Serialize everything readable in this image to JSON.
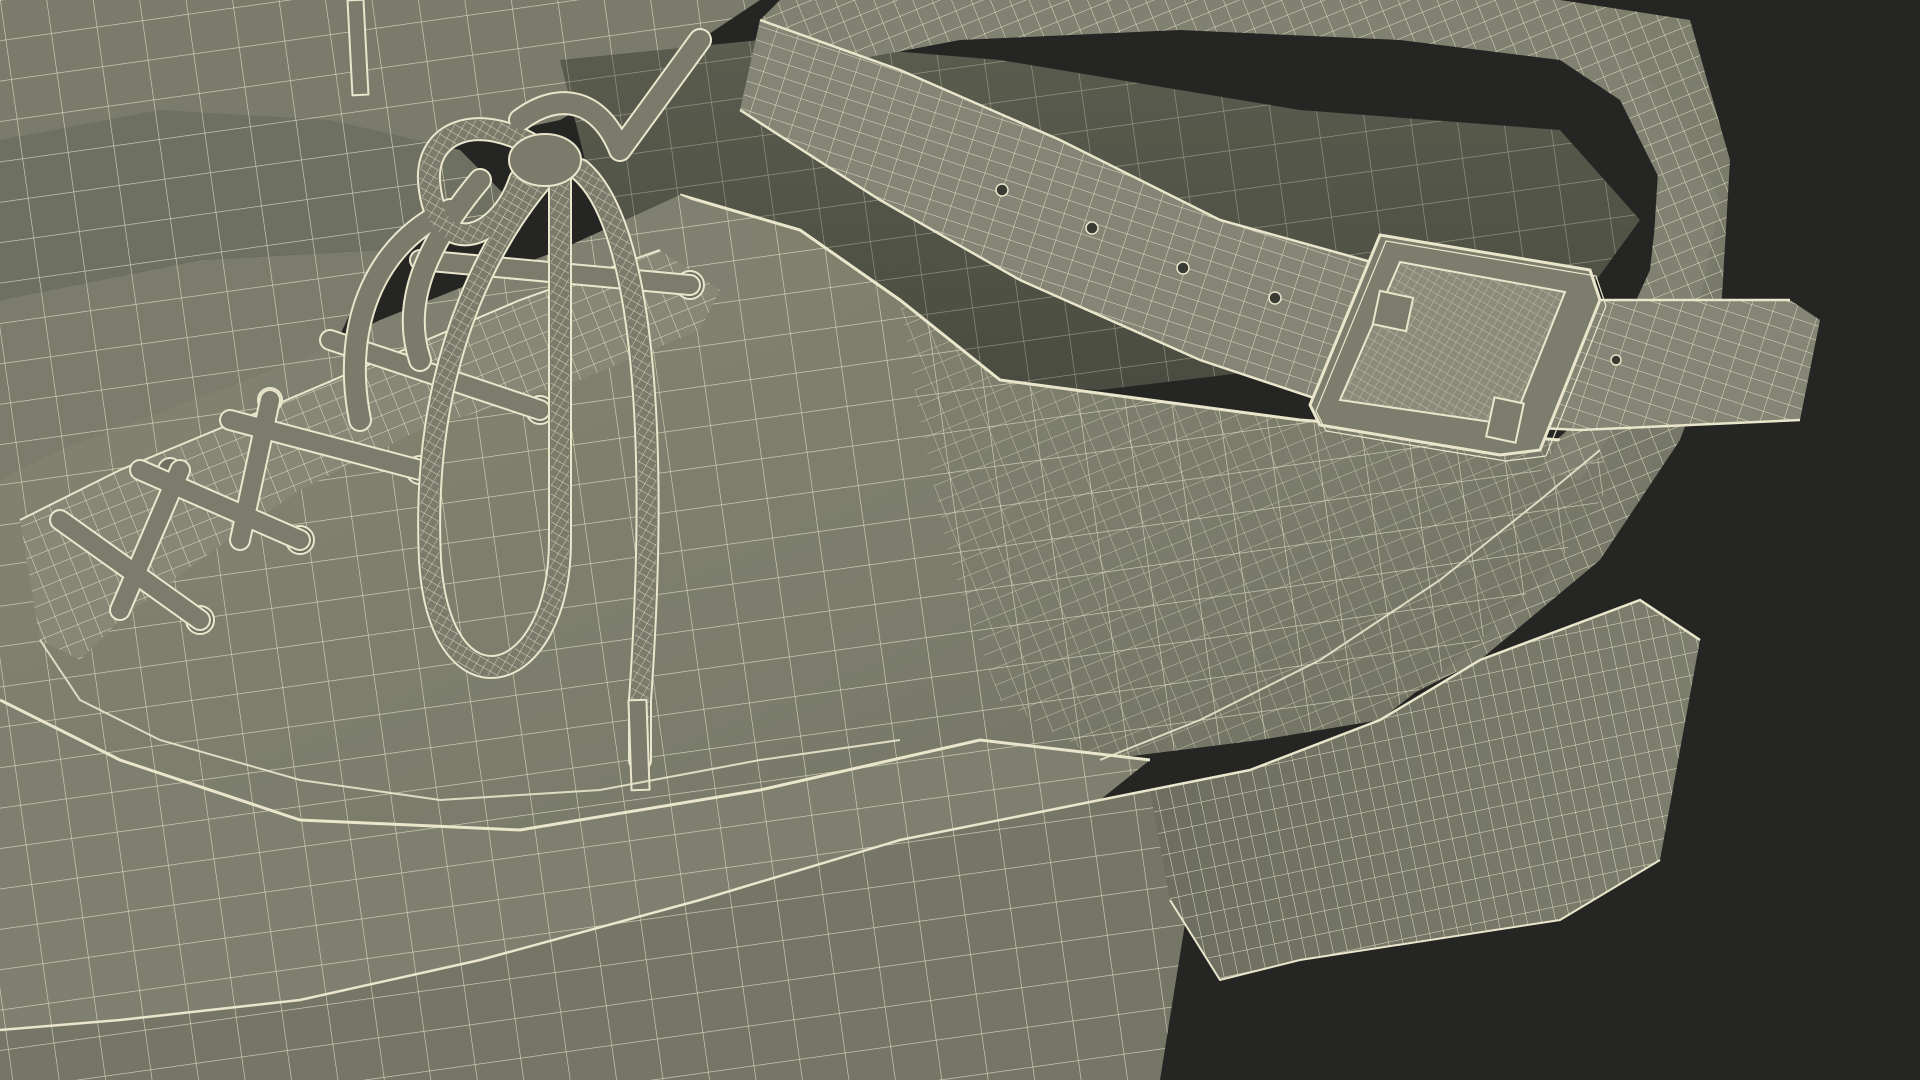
{
  "scene": {
    "subject": "shoe-wireframe-render",
    "colors": {
      "background": "#252624",
      "surface": "#7d7d6d",
      "surface_light": "#8a8a79",
      "surface_dark": "#5f6152",
      "inner_shadow": "#4a4c40",
      "wire": "#e9e6cc",
      "lace": "#7a7b6b"
    }
  }
}
